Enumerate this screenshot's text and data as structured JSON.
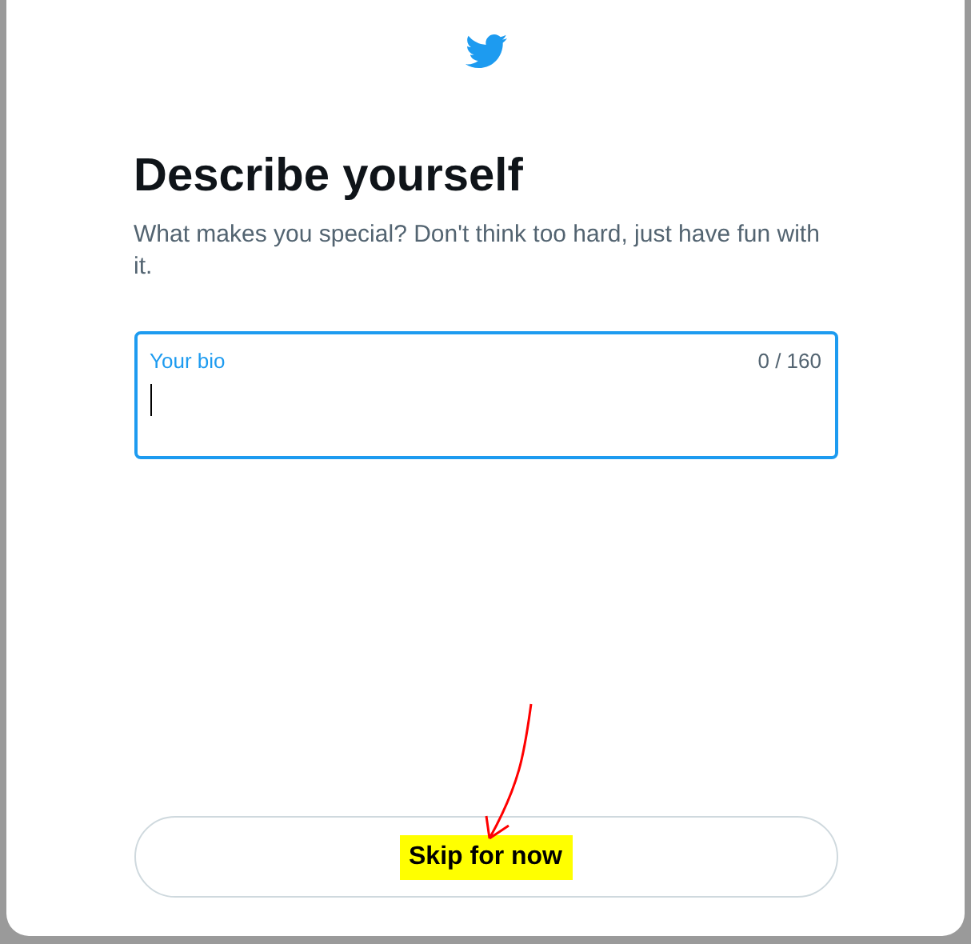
{
  "heading": "Describe yourself",
  "subtitle": "What makes you special? Don't think too hard, just have fun with it.",
  "bio_field": {
    "label": "Your bio",
    "counter": "0 / 160",
    "focused": true
  },
  "skip_button": {
    "label": "Skip for now",
    "highlighted": true
  }
}
